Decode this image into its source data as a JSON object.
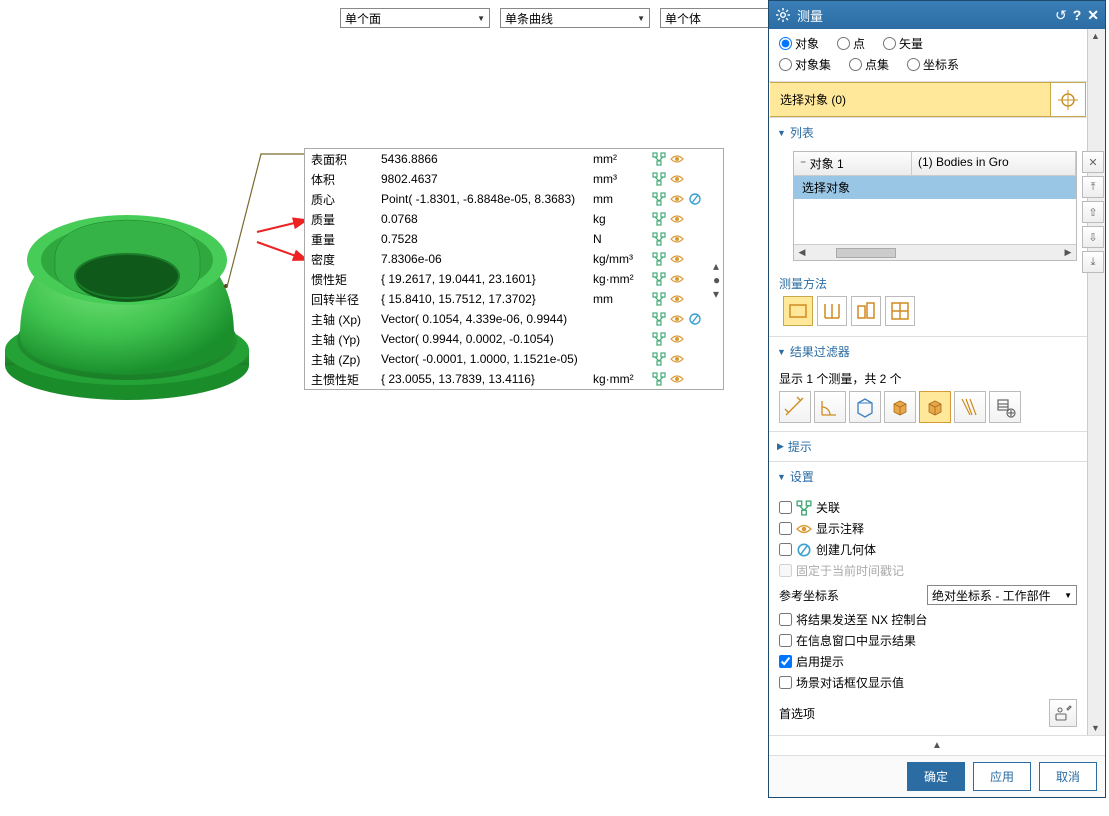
{
  "topbar": {
    "face": "单个面",
    "curve": "单条曲线",
    "body": "单个体"
  },
  "props": {
    "rows": [
      {
        "label": "表面积",
        "value": "5436.8866",
        "unit": "mm²",
        "icons": [
          "tree",
          "eye"
        ]
      },
      {
        "label": "体积",
        "value": "9802.4637",
        "unit": "mm³",
        "icons": [
          "tree",
          "eye"
        ]
      },
      {
        "label": "质心",
        "value": "Point( -1.8301, -6.8848e-05, 8.3683)",
        "unit": "mm",
        "icons": [
          "tree",
          "eye",
          "geo"
        ]
      },
      {
        "label": "质量",
        "value": "0.0768",
        "unit": "kg",
        "icons": [
          "tree",
          "eye"
        ]
      },
      {
        "label": "重量",
        "value": "0.7528",
        "unit": "N",
        "icons": [
          "tree",
          "eye"
        ]
      },
      {
        "label": "密度",
        "value": "7.8306e-06",
        "unit": "kg/mm³",
        "icons": [
          "tree",
          "eye"
        ]
      },
      {
        "label": "惯性矩",
        "value": "{ 19.2617, 19.0441, 23.1601}",
        "unit": "kg·mm²",
        "icons": [
          "tree",
          "eye"
        ]
      },
      {
        "label": "回转半径",
        "value": "{ 15.8410, 15.7512, 17.3702}",
        "unit": "mm",
        "icons": [
          "tree",
          "eye"
        ]
      },
      {
        "label": "主轴 (Xp)",
        "value": "Vector( 0.1054, 4.339e-06, 0.9944)",
        "unit": "",
        "icons": [
          "tree",
          "eye",
          "geo"
        ]
      },
      {
        "label": "主轴 (Yp)",
        "value": "Vector( 0.9944, 0.0002, -0.1054)",
        "unit": "",
        "icons": [
          "tree",
          "eye"
        ]
      },
      {
        "label": "主轴 (Zp)",
        "value": "Vector( -0.0001, 1.0000, 1.1521e-05)",
        "unit": "",
        "icons": [
          "tree",
          "eye"
        ]
      },
      {
        "label": "主惯性矩",
        "value": "{ 23.0055, 13.7839, 13.4116}",
        "unit": "kg·mm²",
        "icons": [
          "tree",
          "eye"
        ]
      }
    ]
  },
  "panel": {
    "title": "测量",
    "radios": {
      "r1": [
        "对象",
        "点",
        "矢量"
      ],
      "r2": [
        "对象集",
        "点集",
        "坐标系"
      ]
    },
    "sel": "选择对象 (0)",
    "list_section": "列表",
    "obj_list": {
      "col1": "对象 1",
      "col2": "(1) Bodies in Gro",
      "row1": "选择对象"
    },
    "method": "测量方法",
    "filter_section": "结果过滤器",
    "filter_text": "显示 1 个测量，共 2 个",
    "tips": "提示",
    "settings_section": "设置",
    "chk_assoc": "关联",
    "chk_annot": "显示注释",
    "chk_geo": "创建几何体",
    "chk_lock": "固定于当前时间戳记",
    "cs_label": "参考坐标系",
    "cs_value": "绝对坐标系 - 工作部件",
    "chk_nx": "将结果发送至 NX 控制台",
    "chk_info": "在信息窗口中显示结果",
    "chk_prompt": "启用提示",
    "chk_scene": "场景对话框仅显示值",
    "pref": "首选项"
  },
  "footer": {
    "ok": "确定",
    "apply": "应用",
    "cancel": "取消"
  }
}
